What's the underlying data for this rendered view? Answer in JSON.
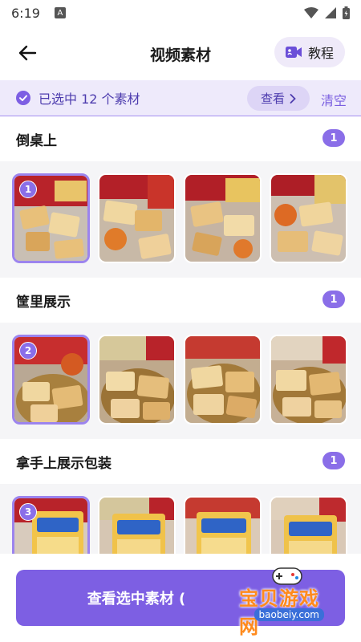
{
  "status_bar": {
    "time": "6:19",
    "notification_letter": "A"
  },
  "header": {
    "title": "视频素材",
    "tutorial_label": "教程"
  },
  "selection_bar": {
    "text": "已选中 12 个素材",
    "view_label": "查看",
    "clear_label": "清空"
  },
  "sections": [
    {
      "title": "倒桌上",
      "count": "1",
      "selected_badge": "1"
    },
    {
      "title": "筐里展示",
      "count": "1",
      "selected_badge": "2"
    },
    {
      "title": "拿手上展示包装",
      "count": "1",
      "selected_badge": "3"
    }
  ],
  "primary_button": {
    "label": "查看选中素材 ("
  },
  "watermark": {
    "name": "宝贝游戏网",
    "url": "baobeiy.com"
  },
  "colors": {
    "accent": "#7d5fe3",
    "accent_light": "#eeeafb",
    "badge": "#8a6ee8"
  }
}
